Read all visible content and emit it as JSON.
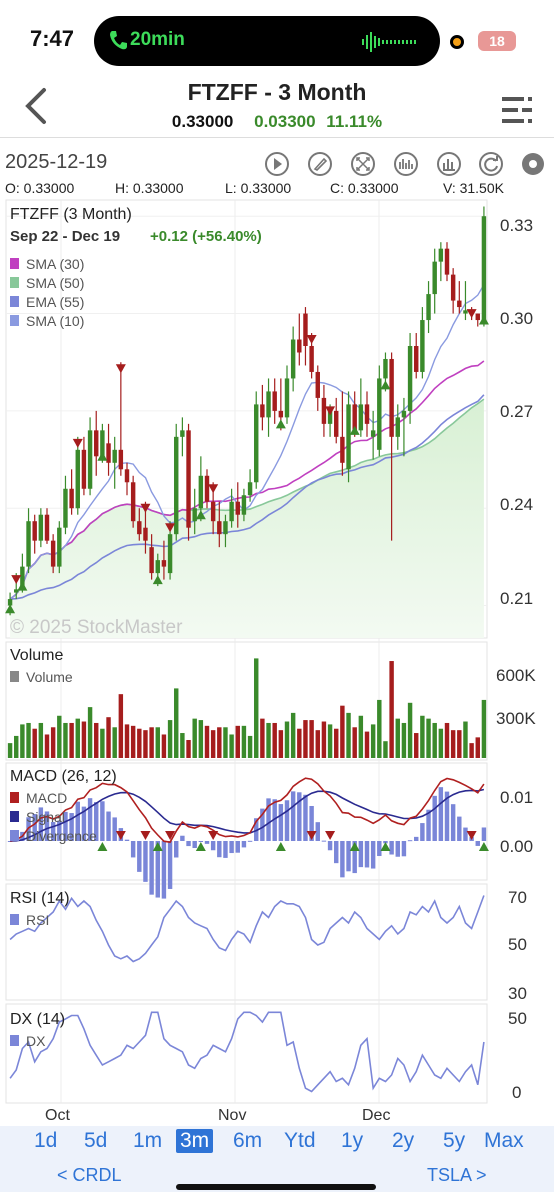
{
  "status": {
    "time": "7:47",
    "call_duration": "20min",
    "battery": "18"
  },
  "header": {
    "title": "FTZFF - 3 Month",
    "price": "0.33000",
    "change": "0.03300",
    "change_pct": "11.11%"
  },
  "chart_header": {
    "date": "2025-12-19",
    "ohlc": {
      "open": "O: 0.33000",
      "high": "H: 0.33000",
      "low": "L: 0.33000",
      "close": "C: 0.33000",
      "volume": "V: 31.50K"
    }
  },
  "toolbar_icons": [
    "play-icon",
    "draw-icon",
    "fullscreen-icon",
    "indicators-icon",
    "chart-type-icon",
    "refresh-icon",
    "settings-icon"
  ],
  "colors": {
    "up": "#3a8a2b",
    "down": "#a51d1d",
    "sma30": "#c040c0",
    "sma50": "#88c89a",
    "ema55": "#7b86d8",
    "sma10": "#8a9ae0",
    "macd": "#b02020",
    "signal": "#2a2a90",
    "hist": "#7a86d8",
    "rsi": "#7b86d8",
    "dx": "#7b86d8",
    "accent": "#2f74d6"
  },
  "chart_data": [
    {
      "type": "candlestick",
      "title": "FTZFF (3 Month)",
      "subtitle": "Sep 22 - Dec 19",
      "change_text": "+0.12 (+56.40%)",
      "watermark": "© 2025 StockMaster",
      "legend": [
        "SMA (30)",
        "SMA (50)",
        "EMA (55)",
        "SMA (10)"
      ],
      "yticks": [
        "0.33",
        "0.30",
        "0.27",
        "0.24",
        "0.21"
      ],
      "xticks": [
        "Oct",
        "Nov",
        "Dec"
      ],
      "ylim": [
        0.2,
        0.335
      ],
      "candles": [
        [
          0.21,
          0.214,
          0.207,
          0.212
        ],
        [
          0.214,
          0.22,
          0.212,
          0.215
        ],
        [
          0.216,
          0.226,
          0.214,
          0.222
        ],
        [
          0.222,
          0.24,
          0.22,
          0.236
        ],
        [
          0.236,
          0.238,
          0.226,
          0.23
        ],
        [
          0.23,
          0.24,
          0.228,
          0.238
        ],
        [
          0.238,
          0.24,
          0.229,
          0.23
        ],
        [
          0.23,
          0.232,
          0.22,
          0.222
        ],
        [
          0.222,
          0.236,
          0.22,
          0.234
        ],
        [
          0.234,
          0.25,
          0.232,
          0.246
        ],
        [
          0.246,
          0.252,
          0.238,
          0.24
        ],
        [
          0.24,
          0.262,
          0.238,
          0.258
        ],
        [
          0.258,
          0.262,
          0.244,
          0.246
        ],
        [
          0.246,
          0.268,
          0.244,
          0.264
        ],
        [
          0.264,
          0.27,
          0.25,
          0.256
        ],
        [
          0.256,
          0.266,
          0.254,
          0.264
        ],
        [
          0.26,
          0.266,
          0.25,
          0.254
        ],
        [
          0.254,
          0.262,
          0.246,
          0.258
        ],
        [
          0.258,
          0.285,
          0.25,
          0.252
        ],
        [
          0.252,
          0.254,
          0.244,
          0.248
        ],
        [
          0.248,
          0.25,
          0.234,
          0.236
        ],
        [
          0.236,
          0.24,
          0.23,
          0.232
        ],
        [
          0.234,
          0.242,
          0.226,
          0.23
        ],
        [
          0.228,
          0.232,
          0.218,
          0.22
        ],
        [
          0.22,
          0.226,
          0.216,
          0.224
        ],
        [
          0.224,
          0.23,
          0.218,
          0.222
        ],
        [
          0.22,
          0.236,
          0.218,
          0.232
        ],
        [
          0.232,
          0.266,
          0.23,
          0.262
        ],
        [
          0.262,
          0.268,
          0.256,
          0.264
        ],
        [
          0.264,
          0.266,
          0.23,
          0.234
        ],
        [
          0.236,
          0.246,
          0.232,
          0.24
        ],
        [
          0.24,
          0.256,
          0.236,
          0.25
        ],
        [
          0.25,
          0.252,
          0.24,
          0.242
        ],
        [
          0.242,
          0.248,
          0.232,
          0.236
        ],
        [
          0.236,
          0.242,
          0.228,
          0.232
        ],
        [
          0.232,
          0.238,
          0.228,
          0.236
        ],
        [
          0.236,
          0.246,
          0.234,
          0.242
        ],
        [
          0.242,
          0.248,
          0.234,
          0.238
        ],
        [
          0.238,
          0.246,
          0.236,
          0.244
        ],
        [
          0.244,
          0.252,
          0.242,
          0.248
        ],
        [
          0.248,
          0.276,
          0.246,
          0.272
        ],
        [
          0.272,
          0.278,
          0.264,
          0.268
        ],
        [
          0.268,
          0.28,
          0.262,
          0.276
        ],
        [
          0.276,
          0.28,
          0.266,
          0.27
        ],
        [
          0.27,
          0.28,
          0.264,
          0.268
        ],
        [
          0.268,
          0.284,
          0.266,
          0.28
        ],
        [
          0.28,
          0.296,
          0.276,
          0.292
        ],
        [
          0.292,
          0.3,
          0.284,
          0.288
        ],
        [
          0.3,
          0.302,
          0.284,
          0.29
        ],
        [
          0.29,
          0.294,
          0.28,
          0.282
        ],
        [
          0.282,
          0.284,
          0.27,
          0.274
        ],
        [
          0.274,
          0.278,
          0.262,
          0.266
        ],
        [
          0.266,
          0.272,
          0.262,
          0.27
        ],
        [
          0.27,
          0.274,
          0.26,
          0.262
        ],
        [
          0.262,
          0.276,
          0.25,
          0.254
        ],
        [
          0.252,
          0.276,
          0.248,
          0.272
        ],
        [
          0.272,
          0.276,
          0.262,
          0.264
        ],
        [
          0.264,
          0.28,
          0.262,
          0.272
        ],
        [
          0.272,
          0.276,
          0.262,
          0.266
        ],
        [
          0.262,
          0.27,
          0.255,
          0.264
        ],
        [
          0.258,
          0.284,
          0.256,
          0.28
        ],
        [
          0.28,
          0.288,
          0.276,
          0.286
        ],
        [
          0.286,
          0.288,
          0.23,
          0.262
        ],
        [
          0.262,
          0.272,
          0.258,
          0.268
        ],
        [
          0.268,
          0.274,
          0.256,
          0.27
        ],
        [
          0.27,
          0.294,
          0.266,
          0.29
        ],
        [
          0.29,
          0.294,
          0.28,
          0.282
        ],
        [
          0.282,
          0.302,
          0.28,
          0.298
        ],
        [
          0.298,
          0.31,
          0.294,
          0.306
        ],
        [
          0.306,
          0.32,
          0.3,
          0.316
        ],
        [
          0.316,
          0.322,
          0.31,
          0.32
        ],
        [
          0.32,
          0.322,
          0.31,
          0.312
        ],
        [
          0.312,
          0.314,
          0.3,
          0.304
        ],
        [
          0.304,
          0.31,
          0.3,
          0.302
        ],
        [
          0.3,
          0.31,
          0.298,
          0.301
        ],
        [
          0.301,
          0.302,
          0.298,
          0.3
        ],
        [
          0.3,
          0.3,
          0.296,
          0.298
        ],
        [
          0.298,
          0.333,
          0.296,
          0.33
        ]
      ],
      "markers_up": [
        0,
        2,
        15,
        24,
        31,
        44,
        56,
        61,
        77
      ],
      "markers_down": [
        1,
        11,
        18,
        22,
        26,
        33,
        49,
        52,
        75
      ]
    },
    {
      "type": "bar",
      "title": "Volume",
      "legend": [
        "Volume"
      ],
      "yticks": [
        "600K",
        "300K"
      ],
      "ylim": [
        0,
        900
      ]
    },
    {
      "type": "line",
      "title": "MACD (26, 12)",
      "legend": [
        "MACD",
        "Signal",
        "Divergence"
      ],
      "yticks": [
        "0.01",
        "0.00"
      ],
      "ylim": [
        -0.008,
        0.016
      ]
    },
    {
      "type": "line",
      "title": "RSI (14)",
      "legend": [
        "RSI"
      ],
      "yticks": [
        "70",
        "50",
        "30"
      ],
      "ylim": [
        30,
        70
      ],
      "values": [
        52,
        54,
        55,
        56,
        55,
        58,
        60,
        62,
        66,
        63,
        67,
        64,
        66,
        64,
        59,
        55,
        50,
        46,
        45,
        46,
        44,
        45,
        47,
        50,
        53,
        60,
        63,
        66,
        64,
        60,
        58,
        57,
        56,
        52,
        49,
        48,
        52,
        55,
        54,
        51,
        57,
        62,
        60,
        64,
        66,
        65,
        65,
        64,
        60,
        52,
        50,
        51,
        56,
        58,
        60,
        58,
        62,
        60,
        56,
        54,
        52,
        55,
        57,
        54,
        56,
        62,
        61,
        64,
        62,
        66,
        60,
        58,
        60,
        64,
        58,
        56,
        62,
        68
      ]
    },
    {
      "type": "line",
      "title": "DX (14)",
      "legend": [
        "DX"
      ],
      "yticks": [
        "50",
        "0"
      ],
      "ylim": [
        -5,
        55
      ],
      "values": [
        10,
        15,
        28,
        32,
        20,
        26,
        28,
        34,
        44,
        46,
        48,
        48,
        40,
        30,
        24,
        18,
        20,
        22,
        24,
        30,
        28,
        32,
        36,
        50,
        50,
        34,
        30,
        28,
        26,
        18,
        16,
        22,
        24,
        30,
        28,
        26,
        34,
        46,
        50,
        50,
        48,
        44,
        50,
        50,
        50,
        30,
        32,
        16,
        4,
        2,
        6,
        10,
        14,
        8,
        10,
        6,
        16,
        30,
        34,
        4,
        10,
        8,
        12,
        22,
        18,
        8,
        14,
        24,
        18,
        12,
        10,
        16,
        12,
        8,
        14,
        18,
        6,
        32
      ]
    }
  ],
  "x_labels": [
    "Oct",
    "Nov",
    "Dec"
  ],
  "ranges": [
    "1d",
    "5d",
    "1m",
    "3m",
    "6m",
    "Ytd",
    "1y",
    "2y",
    "5y",
    "Max"
  ],
  "selected_range": "3m",
  "nav": {
    "prev": "< CRDL",
    "next": "TSLA >"
  }
}
